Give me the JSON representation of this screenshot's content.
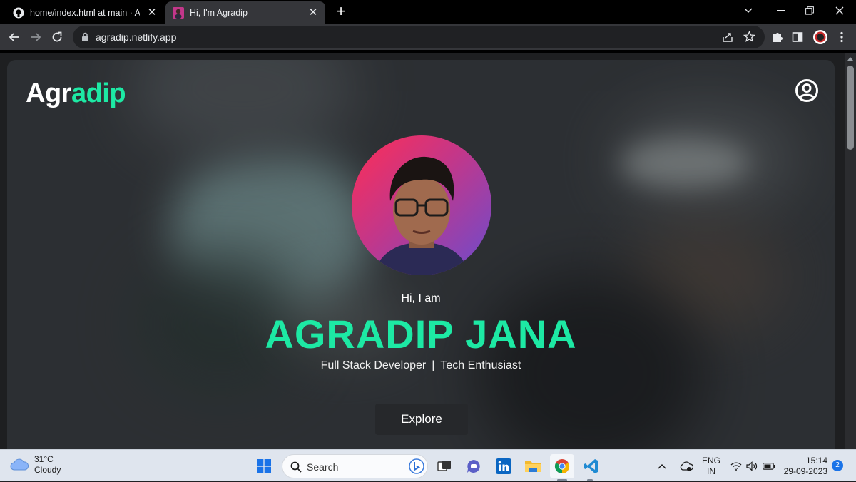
{
  "browser": {
    "tabs": [
      {
        "title": "home/index.html at main · Agra",
        "active": false
      },
      {
        "title": "Hi, I'm Agradip",
        "active": true
      }
    ],
    "url": "agradip.netlify.app"
  },
  "page": {
    "brand_prefix": "Agr",
    "brand_accent": "adip",
    "greeting": "Hi, I am",
    "name": "AGRADIP JANA",
    "role_1": "Full Stack Developer",
    "role_sep": "|",
    "role_2": "Tech Enthusiast",
    "cta": "Explore",
    "accent_color": "#1de9a4"
  },
  "taskbar": {
    "weather_temp": "31°C",
    "weather_desc": "Cloudy",
    "search_label": "Search",
    "lang_1": "ENG",
    "lang_2": "IN",
    "time": "15:14",
    "date": "29-09-2023",
    "notifications": "2"
  }
}
